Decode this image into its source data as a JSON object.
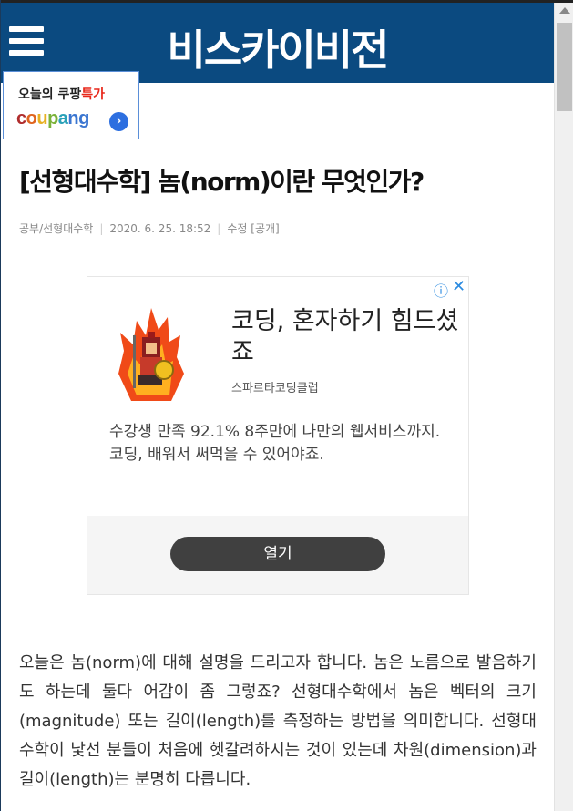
{
  "header": {
    "site_title": "비스카이비전"
  },
  "coupang_banner": {
    "line_prefix": "오늘의 쿠팡",
    "line_highlight": "특가",
    "logo_letters": [
      "c",
      "o",
      "u",
      "p",
      "a",
      "n",
      "g"
    ],
    "logo_colors": [
      "#b02d2d",
      "#e0651f",
      "#e7b023",
      "#7bb23a",
      "#2aa1b8",
      "#3b76d1",
      "#3b76d1"
    ],
    "arrow": "›"
  },
  "post": {
    "title": "[선형대수학] 놈(norm)이란 무엇인가?",
    "category": "공부/선형대수학",
    "date": "2020. 6. 25. 18:52",
    "edit_link": "수정",
    "visibility": "[공개]"
  },
  "ad": {
    "headline": "코딩, 혼자하기 힘드셨죠",
    "brand": "스파르타코딩클럽",
    "body": "수강생 만족 92.1% 8주만에 나만의 웹서비스까지. 코딩, 배워서 써먹을 수 있어야죠.",
    "button_label": "열기",
    "info_icon": "ⓘ",
    "close_icon": "✕"
  },
  "article": {
    "paragraph": "오늘은 놈(norm)에 대해 설명을 드리고자 합니다. 놈은 노름으로 발음하기도 하는데 둘다 어감이 좀 그렇죠? 선형대수학에서 놈은 벡터의 크기(magnitude) 또는 길이(length)를 측정하는 방법을 의미합니다. 선형대수학이 낯선 분들이 처음에 헷갈려하시는 것이 있는데 차원(dimension)과 길이(length)는 분명히 다릅니다."
  },
  "colors": {
    "header_bg": "#0b4a80",
    "accent_red": "#e8271a",
    "ad_link_blue": "#2c8be0"
  }
}
